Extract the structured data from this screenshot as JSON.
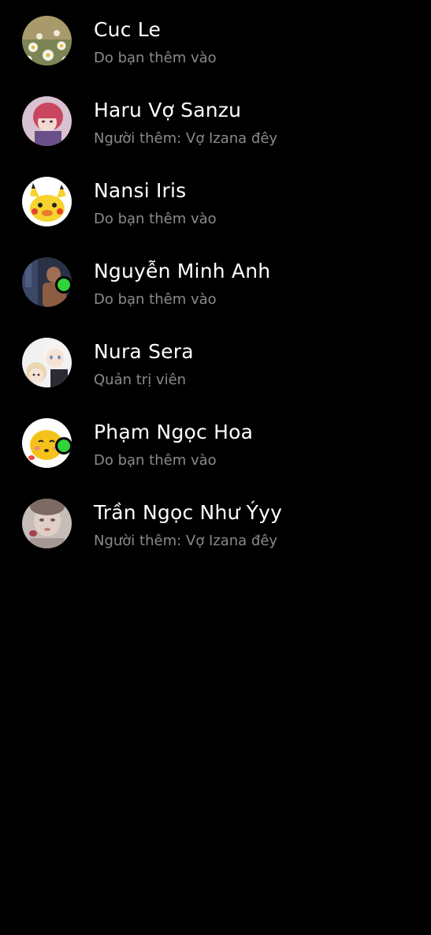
{
  "members": [
    {
      "name": "Cuc Le",
      "subtitle": "Do bạn thêm vào",
      "online": false,
      "avatar_icon": "daisy-field-photo",
      "avatar_colors": [
        "#b7a67a",
        "#6f7a4f"
      ]
    },
    {
      "name": "Haru Vợ Sanzu",
      "subtitle": "Người thêm: Vợ Izana đêy",
      "online": false,
      "avatar_icon": "anime-pink-hair-portrait",
      "avatar_colors": [
        "#d9b7c8",
        "#c0435a"
      ]
    },
    {
      "name": "Nansi Iris",
      "subtitle": "Do bạn thêm vào",
      "online": false,
      "avatar_icon": "pikachu-icon",
      "avatar_colors": [
        "#ffffff",
        "#f6d32d"
      ]
    },
    {
      "name": "Nguyễn Minh Anh",
      "subtitle": "Do bạn thêm vào",
      "online": true,
      "avatar_icon": "dark-figure-photo",
      "avatar_colors": [
        "#2c3348",
        "#9b6a4f"
      ]
    },
    {
      "name": "Nura Sera",
      "subtitle": "Quản trị viên",
      "online": false,
      "avatar_icon": "anime-white-hair-portrait",
      "avatar_colors": [
        "#f2f2f2",
        "#8fa8cc"
      ]
    },
    {
      "name": "Phạm Ngọc Hoa",
      "subtitle": "Do bạn thêm vào",
      "online": true,
      "avatar_icon": "yellow-blob-emoji",
      "avatar_colors": [
        "#ffffff",
        "#f4c21b"
      ]
    },
    {
      "name": "Trần Ngọc Như Ýyy",
      "subtitle": "Người thêm: Vợ Izana đêy",
      "online": false,
      "avatar_icon": "blurred-selfie-photo",
      "avatar_colors": [
        "#c9c2bf",
        "#8f7470"
      ]
    }
  ],
  "colors": {
    "background": "#000000",
    "name_text": "#ffffff",
    "subtitle_text": "#8a8a8a",
    "online_indicator": "#31d23a"
  }
}
